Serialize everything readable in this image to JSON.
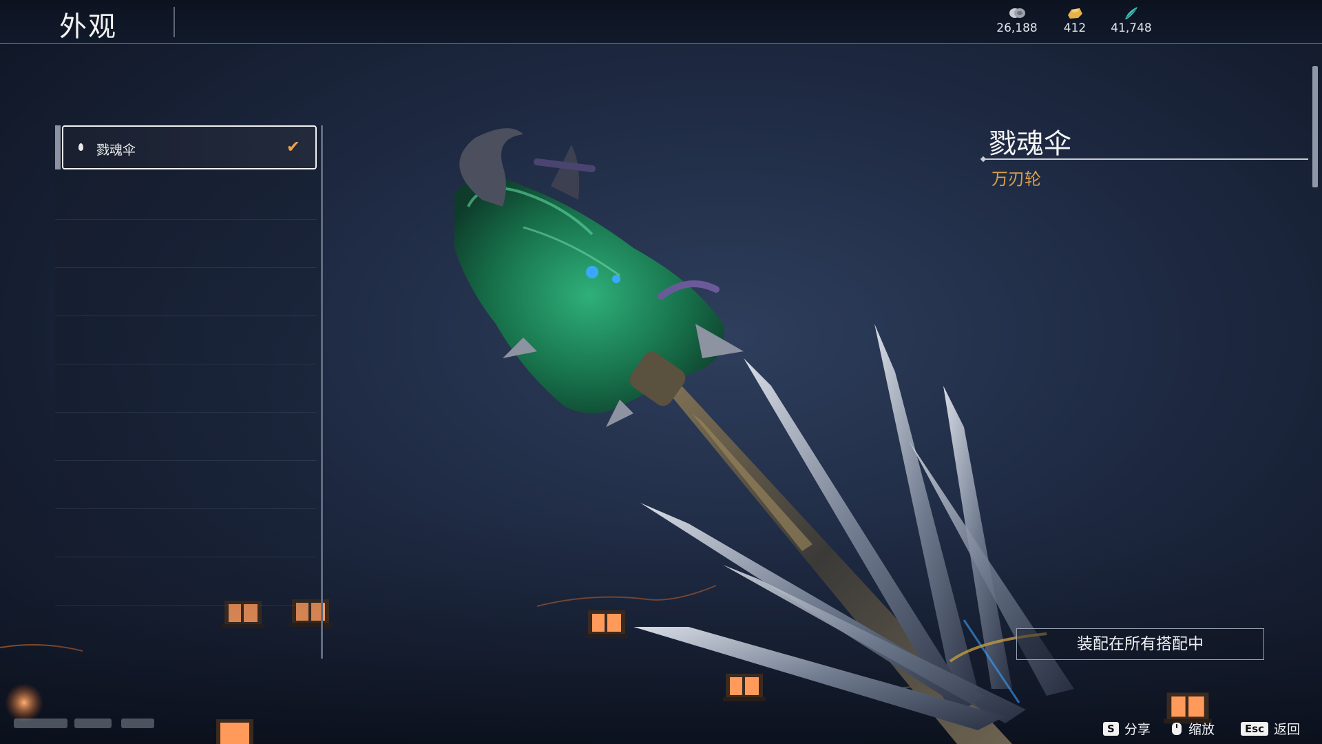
{
  "header": {
    "title": "外观",
    "currencies": [
      {
        "icon": "coin-stack-icon",
        "value": "26,188",
        "color": "#c9ccd2"
      },
      {
        "icon": "gold-ingot-icon",
        "value": "412",
        "color": "#e6b34a"
      },
      {
        "icon": "jade-feather-icon",
        "value": "41,748",
        "color": "#3fc7c0"
      }
    ]
  },
  "list": {
    "items": [
      {
        "label": "戮魂伞",
        "selected": true,
        "equipped": true
      }
    ]
  },
  "detail": {
    "name": "戮魂伞",
    "type": "万刃轮",
    "type_color": "#d9a04a",
    "equip_button": "装配在所有搭配中"
  },
  "hints": [
    {
      "key": "S",
      "label": "分享"
    },
    {
      "key": "mouse",
      "label": "缩放"
    },
    {
      "key": "Esc",
      "label": "返回"
    }
  ],
  "colors": {
    "accent": "#e9a24a",
    "background": "#1f2b44",
    "weapon_green": "#1f8a5c"
  }
}
